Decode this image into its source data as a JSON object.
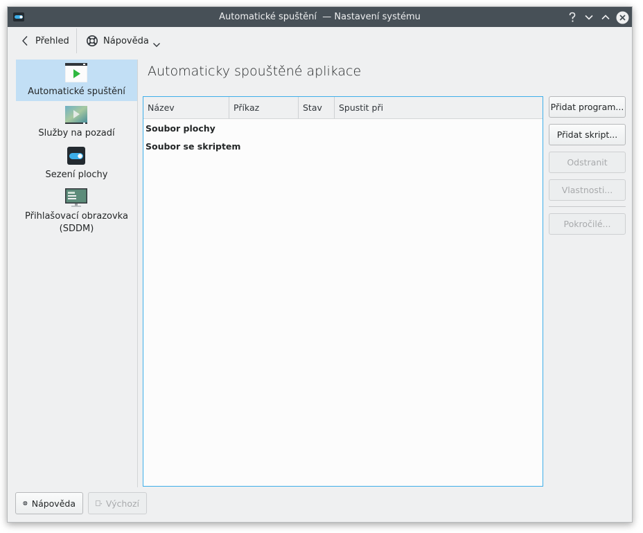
{
  "window": {
    "title": "Automatické spuštění  — Nastavení systému",
    "controls": [
      "help-icon",
      "minimize-icon",
      "maximize-icon",
      "close-icon"
    ]
  },
  "toolbar": {
    "back_label": "Přehled",
    "help_label": "Nápověda"
  },
  "sidebar": {
    "items": [
      {
        "label": "Automatické spuštění",
        "icon": "autostart-icon",
        "active": true
      },
      {
        "label": "Služby na pozadí",
        "icon": "background-services-icon",
        "active": false
      },
      {
        "label": "Sezení plochy",
        "icon": "desktop-session-icon",
        "active": false
      },
      {
        "label": "Přihlašovací obrazovka (SDDM)",
        "icon": "login-screen-icon",
        "active": false
      }
    ]
  },
  "main": {
    "title": "Automaticky spouštěné aplikace",
    "table": {
      "columns": [
        "Název",
        "Příkaz",
        "Stav",
        "Spustit při"
      ],
      "groups": [
        "Soubor plochy",
        "Soubor se skriptem"
      ]
    },
    "buttons": {
      "add_program": "Přidat program...",
      "add_script": "Přidat skript...",
      "remove": "Odstranit",
      "properties": "Vlastnosti...",
      "advanced": "Pokročilé..."
    }
  },
  "footer": {
    "help_label": "Nápověda",
    "defaults_label": "Výchozí"
  },
  "colors": {
    "accent": "#3daee9",
    "selection": "#c2dff5",
    "titlebar": "#475057",
    "window_bg": "#eff0f1"
  }
}
